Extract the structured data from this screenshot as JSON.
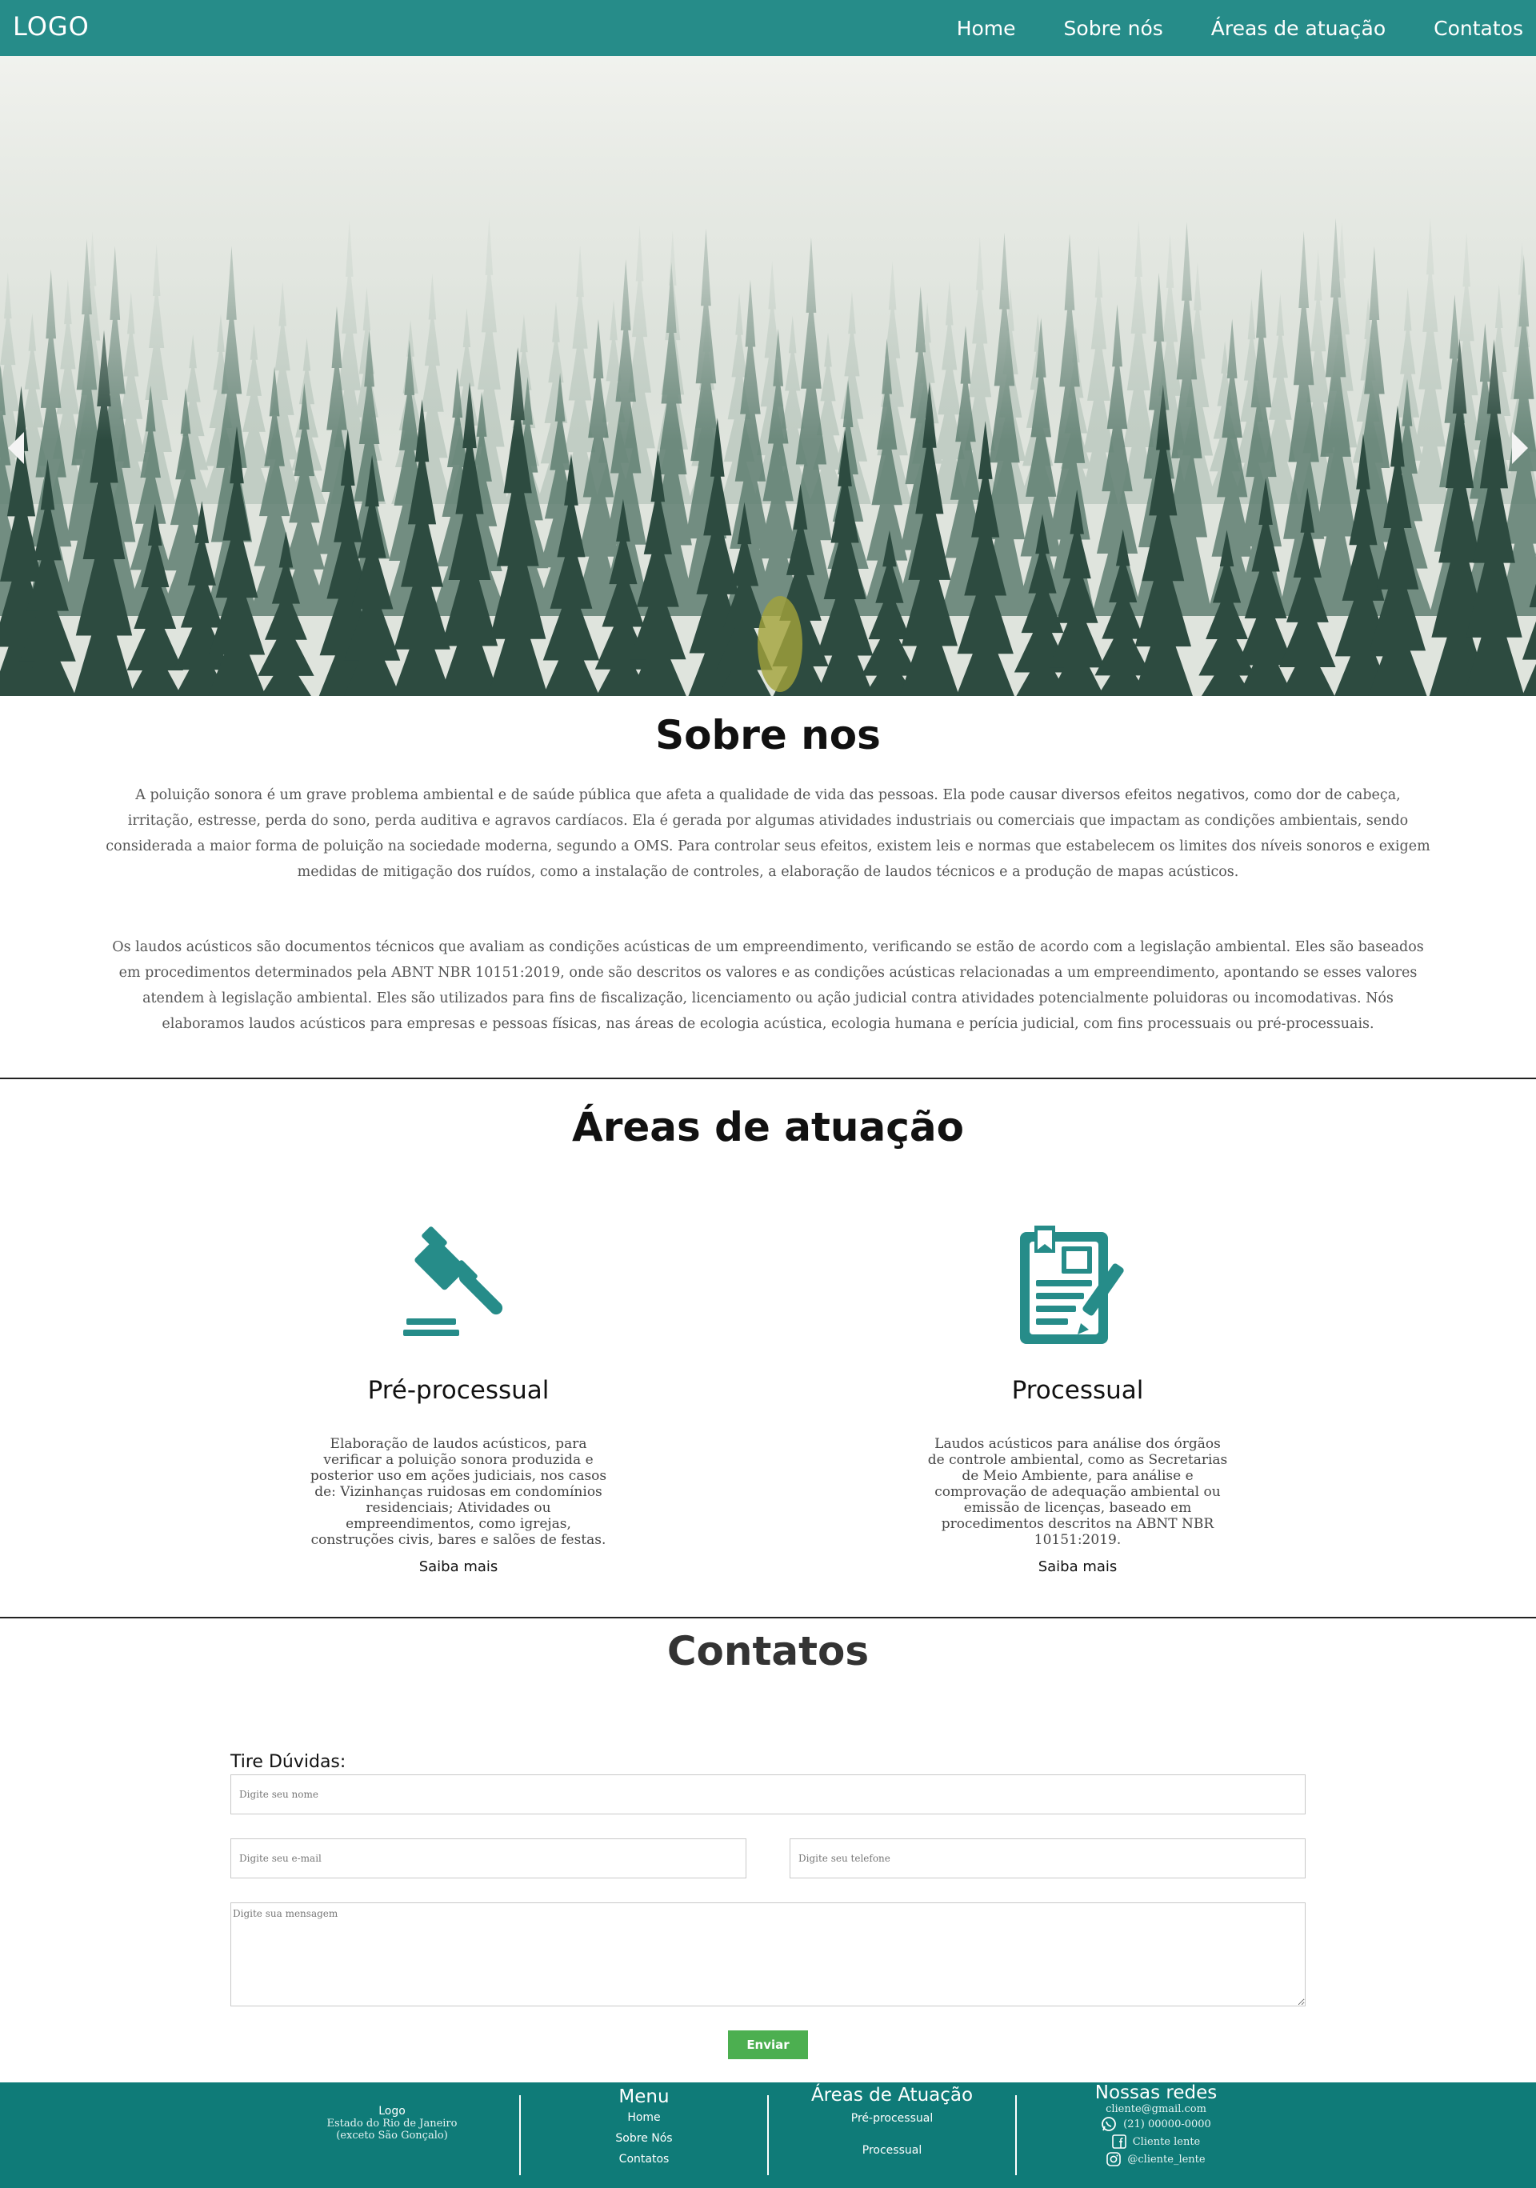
{
  "header": {
    "logo": "LOGO",
    "nav": [
      "Home",
      "Sobre nós",
      "Áreas de atuação",
      "Contatos"
    ]
  },
  "hero": {
    "icons": [
      "arrow-left-icon",
      "arrow-right-icon"
    ]
  },
  "about": {
    "title": "Sobre nos",
    "paragraph1": "A poluição sonora é um grave problema ambiental e de saúde pública que afeta a qualidade de vida das pessoas. Ela pode causar diversos efeitos negativos, como dor de cabeça, irritação, estresse, perda do sono, perda auditiva e agravos cardíacos. Ela é gerada por algumas atividades industriais ou comerciais que impactam as condições ambientais, sendo considerada a maior forma de poluição na sociedade moderna, segundo a OMS. Para controlar seus efeitos, existem leis e normas que estabelecem os limites dos níveis sonoros e exigem medidas de mitigação dos ruídos, como a instalação de controles, a elaboração de laudos técnicos e a produção de mapas acústicos.",
    "paragraph2": "Os laudos acústicos são documentos técnicos que avaliam as condições acústicas de um empreendimento, verificando se estão de acordo com a legislação ambiental. Eles são baseados em procedimentos determinados pela ABNT NBR 10151:2019, onde são descritos os valores e as condições acústicas relacionadas a um empreendimento, apontando se esses valores atendem à legislação ambiental. Eles são utilizados para fins de fiscalização, licenciamento ou ação judicial contra atividades potencialmente poluidoras ou incomodativas. Nós elaboramos laudos acústicos para empresas e pessoas físicas, nas áreas de ecologia acústica, ecologia humana e perícia judicial, com fins processuais ou pré-processuais."
  },
  "areas": {
    "title": "Áreas de atuação",
    "cards": [
      {
        "icon": "gavel-icon",
        "title": "Pré-processual",
        "text": "Elaboração de laudos acústicos, para verificar a poluição sonora produzida e posterior uso em ações judiciais, nos casos de: Vizinhanças ruidosas em condomínios residenciais; Atividades ou empreendimentos, como igrejas, construções civis, bares e salões de festas.",
        "link": "Saiba mais"
      },
      {
        "icon": "document-pen-icon",
        "title": "Processual",
        "text": "Laudos acústicos para análise dos órgãos de controle ambiental, como as Secretarias de Meio Ambiente, para análise e comprovação de adequação ambiental ou emissão de licenças, baseado em procedimentos descritos na ABNT NBR 10151:2019.",
        "link": "Saiba mais"
      }
    ]
  },
  "contacts": {
    "title": "Contatos",
    "form_label": "Tire Dúvidas:",
    "name_placeholder": "Digite seu nome",
    "email_placeholder": "Digite seu e-mail",
    "phone_placeholder": "Digite seu telefone",
    "message_placeholder": "Digite sua mensagem",
    "send_label": "Enviar"
  },
  "footer": {
    "logo_title": "Logo",
    "logo_line1": "Estado do Rio de Janeiro",
    "logo_line2": "(exceto São Gonçalo)",
    "menu_title": "Menu",
    "menu_items": [
      "Home",
      "Sobre Nós",
      "Contatos"
    ],
    "areas_title": "Áreas de Atuação",
    "areas_items": [
      "Pré-processual",
      "Processual"
    ],
    "social_title": "Nossas redes",
    "email": "cliente@gmail.com",
    "phone": "(21) 00000-0000",
    "facebook": "Cliente lente",
    "instagram": "@cliente_lente",
    "social_icons": [
      "whatsapp-icon",
      "facebook-icon",
      "instagram-icon"
    ],
    "colors": {
      "header": "#268c89",
      "footer": "#0f7b78",
      "accent_icon": "#268c89",
      "button": "#4caf50"
    }
  }
}
